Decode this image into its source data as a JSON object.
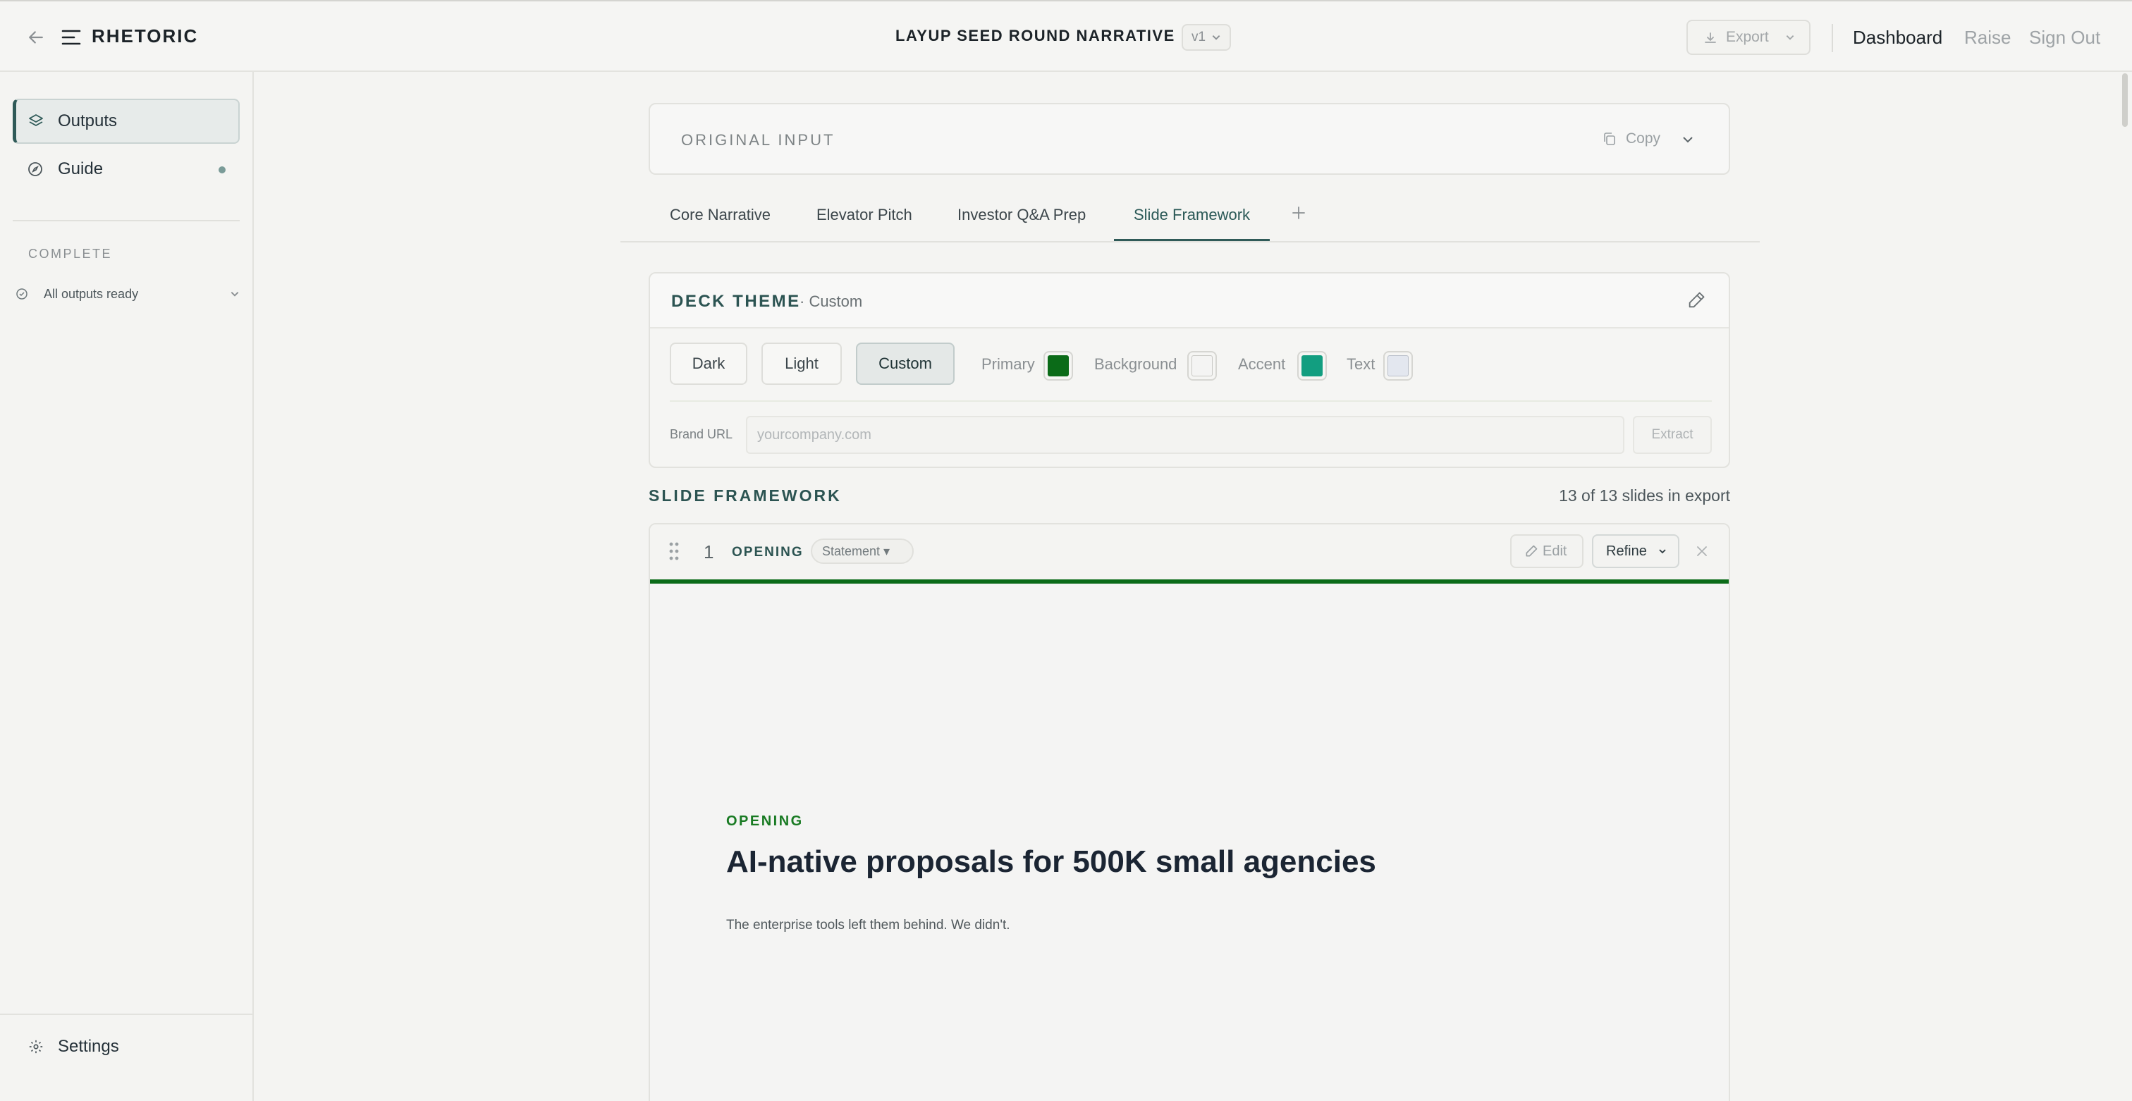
{
  "header": {
    "brand": "RHETORIC",
    "doc_title": "LAYUP SEED ROUND NARRATIVE",
    "version": "v1",
    "export_label": "Export",
    "nav": {
      "dashboard": "Dashboard",
      "raise": "Raise",
      "sign_out": "Sign Out"
    }
  },
  "sidebar": {
    "items": [
      {
        "label": "Outputs",
        "icon": "layers-icon",
        "active": true
      },
      {
        "label": "Guide",
        "icon": "compass-icon",
        "active": false
      }
    ],
    "status_heading": "COMPLETE",
    "status_text": "All outputs ready",
    "settings_label": "Settings"
  },
  "original_input": {
    "label": "ORIGINAL INPUT",
    "copy_label": "Copy"
  },
  "tabs": [
    {
      "label": "Core Narrative",
      "active": false
    },
    {
      "label": "Elevator Pitch",
      "active": false
    },
    {
      "label": "Investor Q&A Prep",
      "active": false
    },
    {
      "label": "Slide Framework",
      "active": true
    }
  ],
  "deck_theme": {
    "title": "DECK THEME",
    "subtitle": "· Custom",
    "modes": [
      "Dark",
      "Light",
      "Custom"
    ],
    "selected_mode": "Custom",
    "swatches": [
      {
        "label": "Primary",
        "color": "#0b6b18"
      },
      {
        "label": "Background",
        "color": "#f4f4f3"
      },
      {
        "label": "Accent",
        "color": "#129e80"
      },
      {
        "label": "Text",
        "color": "#e3e7ef"
      }
    ],
    "brand_url_label": "Brand URL",
    "brand_url_placeholder": "yourcompany.com",
    "brand_url_value": "",
    "extract_label": "Extract"
  },
  "slide_framework": {
    "heading": "SLIDE FRAMEWORK",
    "count_text": "13 of 13 slides in export",
    "slides": [
      {
        "number": "1",
        "section": "OPENING",
        "type": "Statement ▾",
        "edit_label": "Edit",
        "refine_label": "Refine",
        "eyebrow": "OPENING",
        "title": "AI-native proposals for 500K small agencies",
        "subtitle": "The enterprise tools left them behind. We didn't."
      }
    ]
  },
  "colors": {
    "brand_teal": "#2c5452",
    "primary_green": "#0b6b18"
  }
}
